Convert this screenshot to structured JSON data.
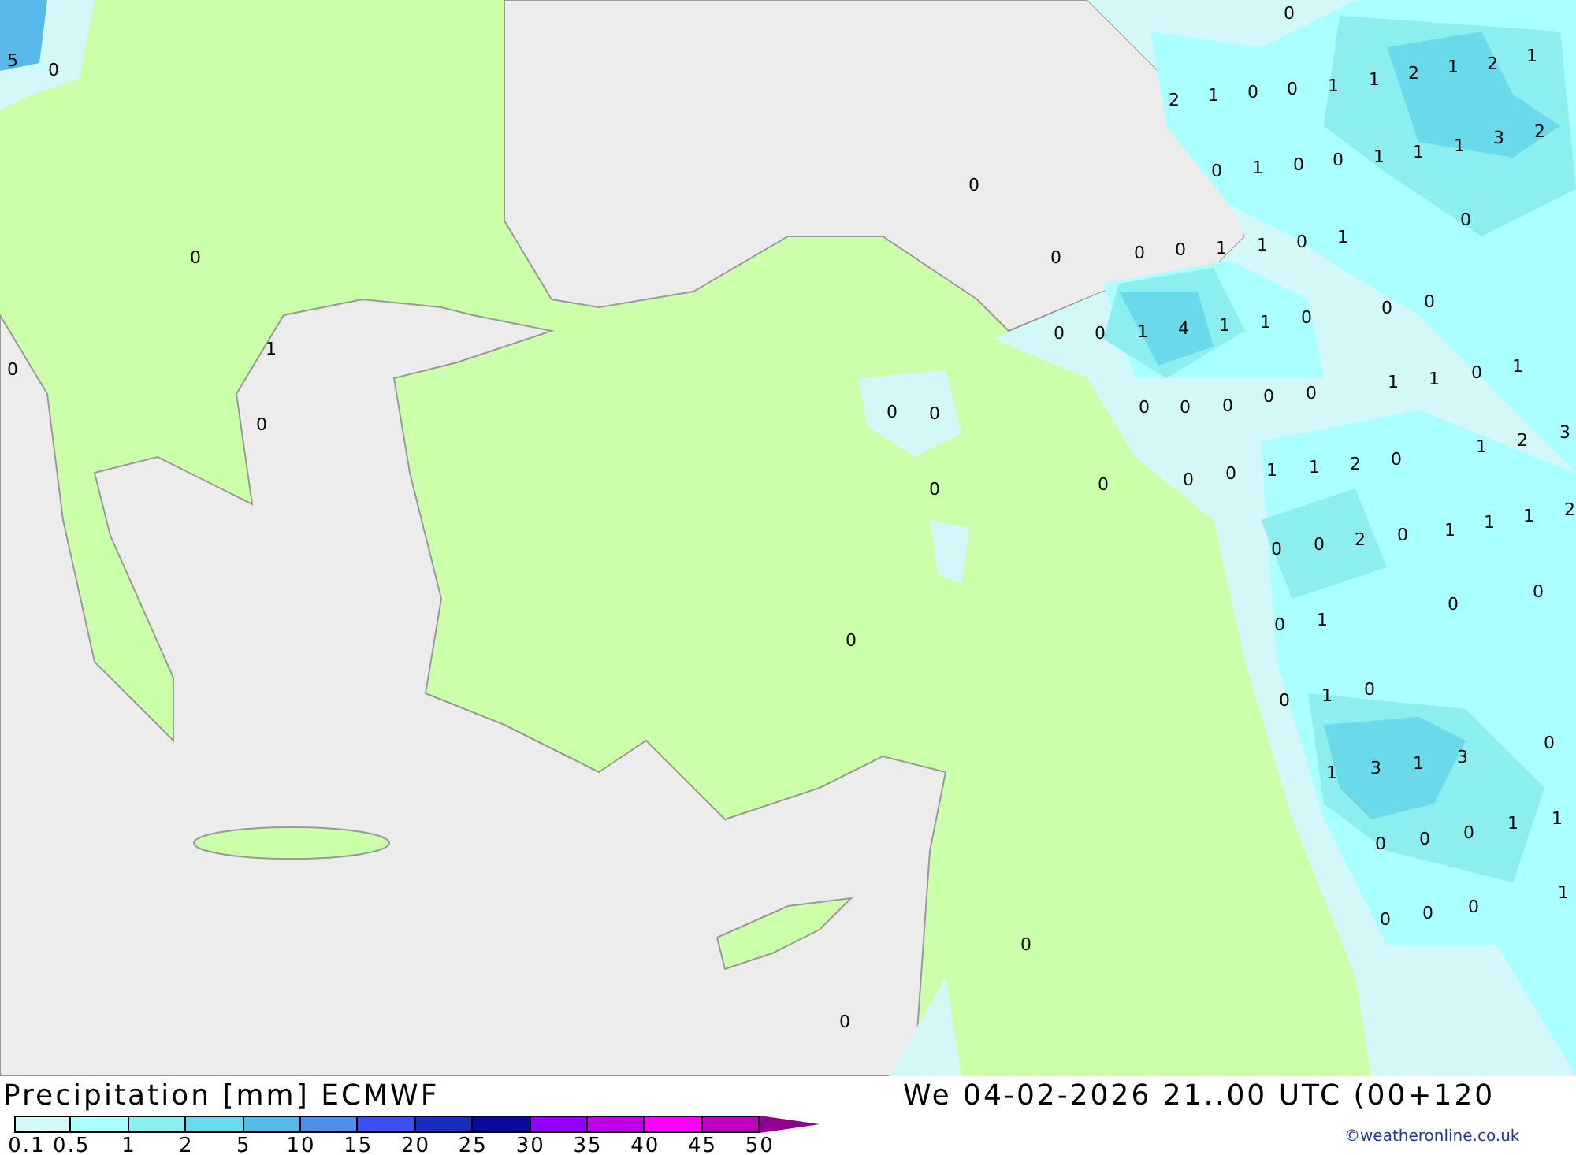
{
  "map": {
    "values": [
      "5",
      "0",
      "0",
      "0",
      "1",
      "0",
      "0",
      "0",
      "2",
      "1",
      "0",
      "0",
      "1",
      "1",
      "2",
      "1",
      "2",
      "1",
      "0",
      "1",
      "0",
      "0",
      "1",
      "1",
      "1",
      "3",
      "2",
      "0",
      "0",
      "0",
      "0",
      "1",
      "1",
      "0",
      "1",
      "0",
      "0",
      "1",
      "4",
      "1",
      "1",
      "0",
      "0",
      "0",
      "1",
      "1",
      "0",
      "1",
      "0",
      "0",
      "0",
      "0",
      "0",
      "0",
      "0",
      "1",
      "2",
      "3",
      "0",
      "0",
      "0",
      "0",
      "1",
      "1",
      "2",
      "0",
      "1",
      "1",
      "1",
      "2",
      "0",
      "0",
      "2",
      "0",
      "0",
      "0",
      "0",
      "1",
      "0",
      "0",
      "1",
      "0",
      "0",
      "1",
      "3",
      "1",
      "3",
      "1",
      "1",
      "0",
      "0",
      "0",
      "1",
      "0",
      "0",
      "0",
      "0",
      "0"
    ]
  },
  "legend": {
    "title": "Precipitation [mm] ECMWF",
    "bands": [
      {
        "color": "#d4f8f8"
      },
      {
        "color": "#aaffff"
      },
      {
        "color": "#8ceeee"
      },
      {
        "color": "#6ad9ea"
      },
      {
        "color": "#58b8e8"
      },
      {
        "color": "#4c8ee8"
      },
      {
        "color": "#3a50f0"
      },
      {
        "color": "#1a2cc0"
      },
      {
        "color": "#0a0a9a"
      },
      {
        "color": "#9000ff"
      },
      {
        "color": "#c000e8"
      },
      {
        "color": "#ff00ff"
      },
      {
        "color": "#c000c0"
      }
    ],
    "ticks": [
      "0.1",
      "0.5",
      "1",
      "2",
      "5",
      "10",
      "15",
      "20",
      "25",
      "30",
      "35",
      "40",
      "45",
      "50"
    ]
  },
  "valid_time": "We 04-02-2026 21..00 UTC (00+120",
  "credit": "©weatheronline.co.uk"
}
